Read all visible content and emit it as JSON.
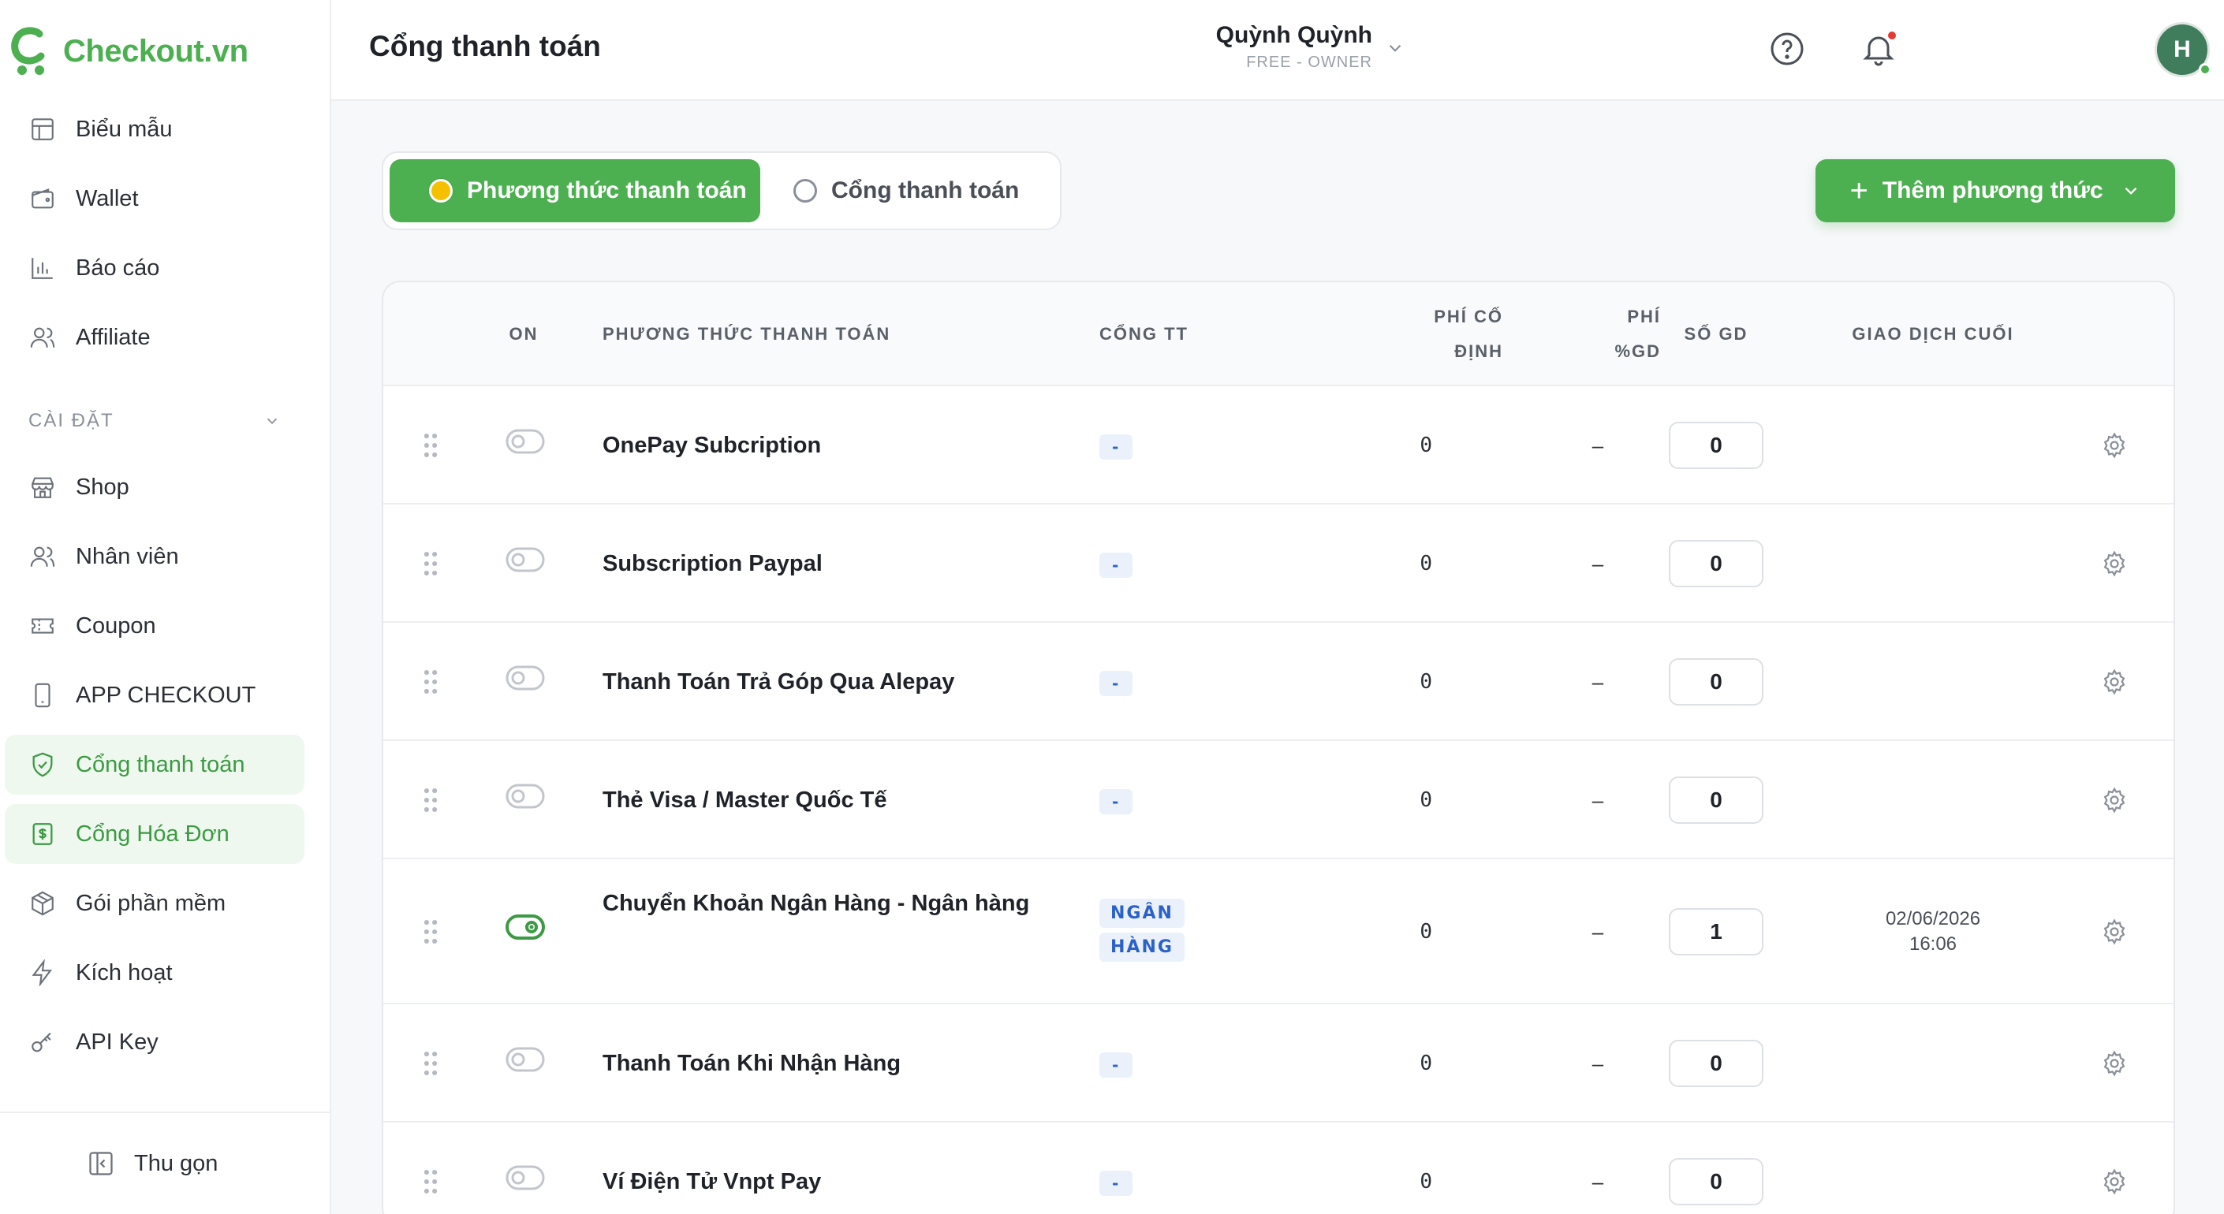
{
  "app": {
    "logo_text": "Checkout.vn"
  },
  "sidebar": {
    "items": [
      {
        "label": "Biểu mẫu",
        "icon": "layout-icon"
      },
      {
        "label": "Wallet",
        "icon": "wallet-icon"
      },
      {
        "label": "Báo cáo",
        "icon": "bar-chart-icon"
      },
      {
        "label": "Affiliate",
        "icon": "users-icon"
      }
    ],
    "section_label": "CÀI ĐẶT",
    "settings_items": [
      {
        "label": "Shop",
        "icon": "store-icon"
      },
      {
        "label": "Nhân viên",
        "icon": "users-icon"
      },
      {
        "label": "Coupon",
        "icon": "ticket-icon"
      },
      {
        "label": "APP CHECKOUT",
        "icon": "phone-icon"
      },
      {
        "label": "Cổng thanh toán",
        "icon": "shield-check-icon",
        "active": true
      },
      {
        "label": "Cổng Hóa Đơn",
        "icon": "invoice-icon",
        "active": true
      },
      {
        "label": "Gói phần mềm",
        "icon": "package-icon"
      },
      {
        "label": "Kích hoạt",
        "icon": "lightning-icon"
      },
      {
        "label": "API Key",
        "icon": "key-icon"
      }
    ],
    "collapse_label": "Thu gọn"
  },
  "header": {
    "title": "Cổng thanh toán",
    "user_name": "Quỳnh Quỳnh",
    "user_role": "FREE - OWNER",
    "avatar_initial": "H"
  },
  "tabs": [
    {
      "label": "Phương thức thanh toán",
      "active": true
    },
    {
      "label": "Cổng thanh toán",
      "active": false
    }
  ],
  "add_button": {
    "label": "Thêm phương thức"
  },
  "table": {
    "columns": {
      "on": "ON",
      "method": "PHƯƠNG THỨC THANH TOÁN",
      "gateway": "CỔNG TT",
      "fixed_fee_1": "PHÍ CỐ",
      "fixed_fee_2": "ĐỊNH",
      "pct_fee_1": "PHÍ",
      "pct_fee_2": "%GD",
      "count": "SỐ GD",
      "last_tx": "GIAO DỊCH CUỐI"
    },
    "rows": [
      {
        "name": "OnePay Subcription",
        "gateway": "-",
        "fixed_fee": "0",
        "pct_fee": "–",
        "count": "0",
        "enabled": false,
        "last_date": "",
        "last_time": ""
      },
      {
        "name": "Subscription Paypal",
        "gateway": "-",
        "fixed_fee": "0",
        "pct_fee": "–",
        "count": "0",
        "enabled": false,
        "last_date": "",
        "last_time": ""
      },
      {
        "name": "Thanh Toán Trả Góp Qua Alepay",
        "gateway": "-",
        "fixed_fee": "0",
        "pct_fee": "–",
        "count": "0",
        "enabled": false,
        "last_date": "",
        "last_time": ""
      },
      {
        "name": "Thẻ Visa / Master Quốc Tế",
        "gateway": "-",
        "fixed_fee": "0",
        "pct_fee": "–",
        "count": "0",
        "enabled": false,
        "last_date": "",
        "last_time": ""
      },
      {
        "name": "Chuyển Khoản Ngân Hàng - Ngân hàng",
        "gateway_line1": "NGÂN",
        "gateway_line2": "HÀNG",
        "fixed_fee": "0",
        "pct_fee": "–",
        "count": "1",
        "enabled": true,
        "last_date": "02/06/2026",
        "last_time": "16:06"
      },
      {
        "name": "Thanh Toán Khi Nhận Hàng",
        "gateway": "-",
        "fixed_fee": "0",
        "pct_fee": "–",
        "count": "0",
        "enabled": false,
        "last_date": "",
        "last_time": ""
      },
      {
        "name": "Ví Điện Tử Vnpt Pay",
        "gateway": "-",
        "fixed_fee": "0",
        "pct_fee": "–",
        "count": "0",
        "enabled": false,
        "last_date": "",
        "last_time": ""
      }
    ]
  },
  "colors": {
    "brand": "#4caf50",
    "active_bg": "#eef8ee",
    "badge_bg": "#eaf1fb",
    "badge_text": "#2c62c8"
  }
}
